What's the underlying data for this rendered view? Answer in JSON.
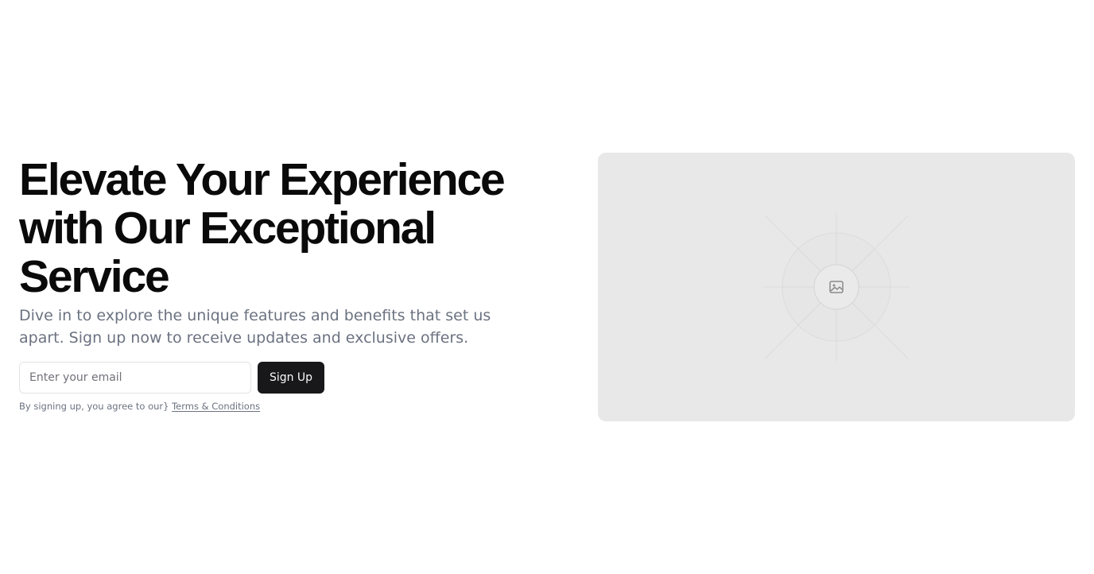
{
  "hero": {
    "headline": "Elevate Your Experience with Our Exceptional Service",
    "subtext": "Dive in to explore the unique features and benefits that set us apart. Sign up now to receive updates and exclusive offers."
  },
  "form": {
    "email_placeholder": "Enter your email",
    "email_value": "",
    "signup_label": "Sign Up"
  },
  "legal": {
    "prefix": "By signing up, you agree to our}",
    "terms_link": "Terms & Conditions"
  },
  "media": {
    "icon": "image-icon"
  },
  "colors": {
    "button_bg": "#18181b",
    "placeholder_bg": "#e8e8e8",
    "muted_text": "#6b7280"
  }
}
